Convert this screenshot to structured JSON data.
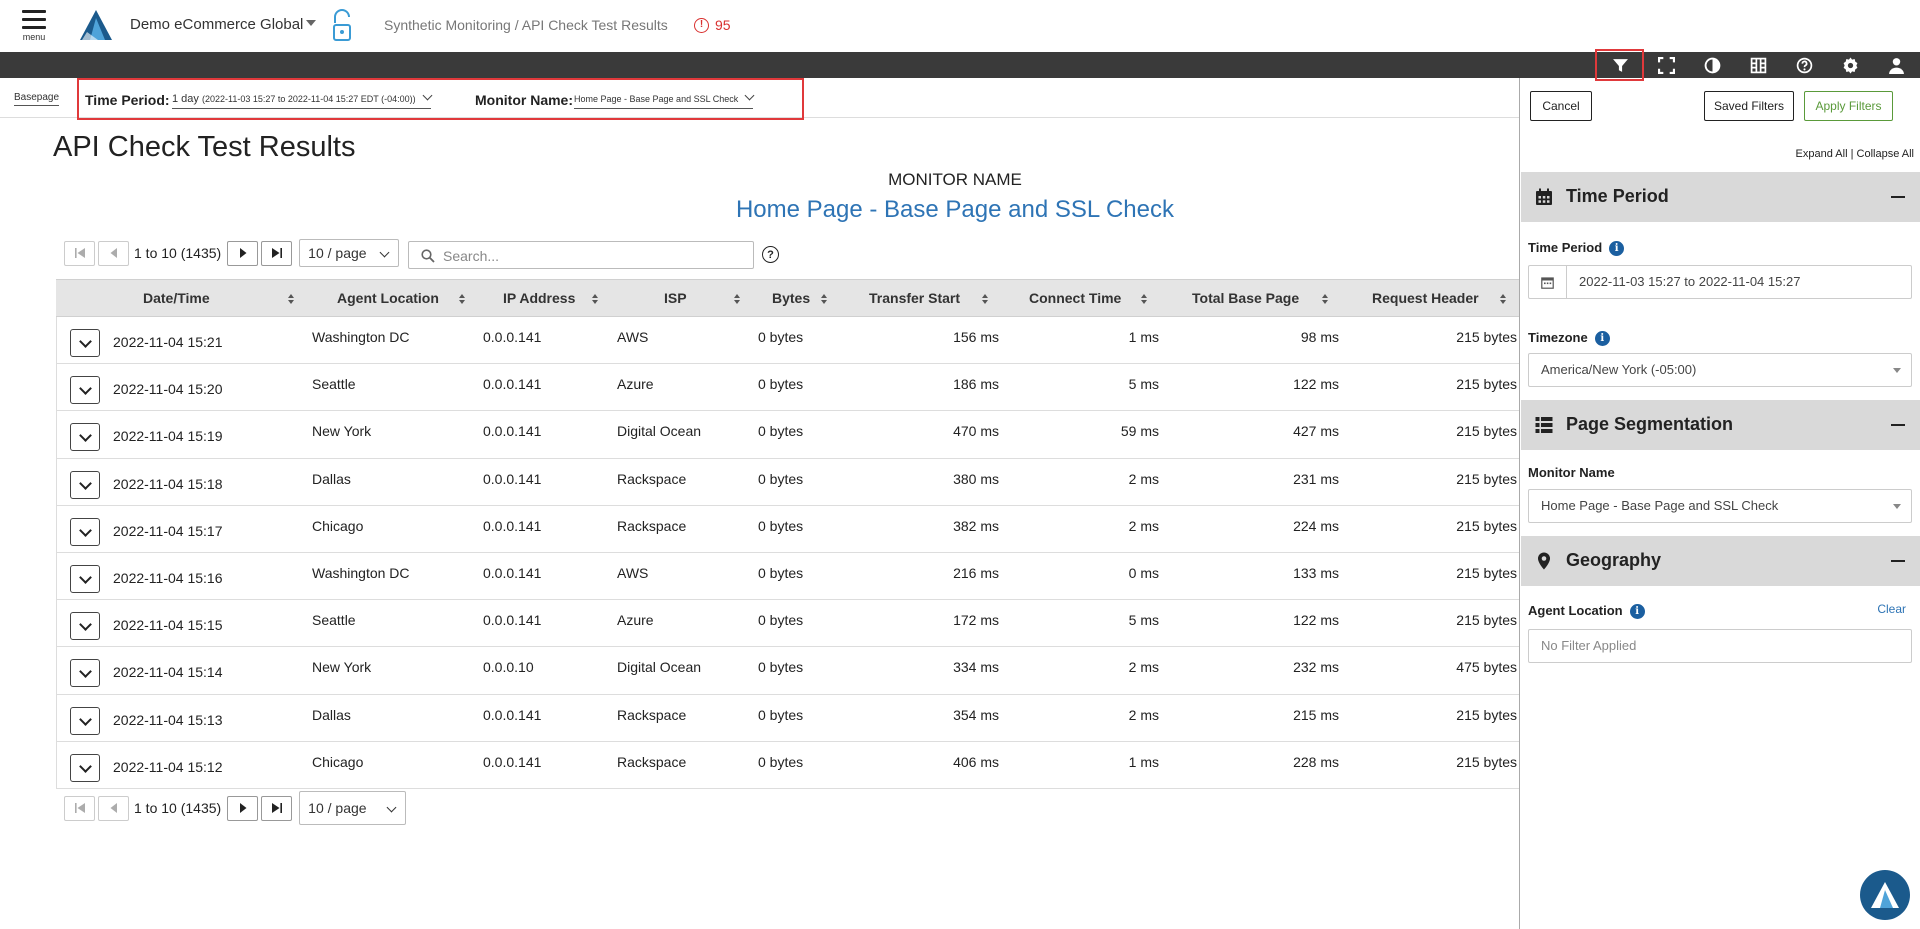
{
  "header": {
    "menu_label": "menu",
    "app_name": "Demo eCommerce Global",
    "breadcrumb": "Synthetic Monitoring / API Check Test Results",
    "alert_count": "95"
  },
  "toolbar": {
    "icons": [
      "filter-icon",
      "fullscreen-icon",
      "contrast-icon",
      "columns-icon",
      "help-icon",
      "gear-icon",
      "user-icon"
    ]
  },
  "filterbar": {
    "basepage": "Basepage",
    "time_period_label": "Time Period:",
    "time_period_value": "1 day",
    "time_period_range": "(2022-11-03 15:27 to 2022-11-04 15:27 EDT (-04:00))",
    "monitor_name_label": "Monitor Name:",
    "monitor_name_value": "Home Page - Base Page and SSL Check"
  },
  "main": {
    "title": "API Check Test Results",
    "monitor_label": "MONITOR NAME",
    "monitor_value": "Home Page - Base Page and SSL Check",
    "pager_count": "1 to 10 (1435)",
    "per_page": "10 / page",
    "search_placeholder": "Search...",
    "help": "?"
  },
  "table": {
    "columns": [
      "Date/Time",
      "Agent Location",
      "IP Address",
      "ISP",
      "Bytes",
      "Transfer Start",
      "Connect Time",
      "Total Base Page",
      "Request Header"
    ],
    "rows": [
      [
        "2022-11-04 15:21",
        "Washington DC",
        "0.0.0.141",
        "AWS",
        "0 bytes",
        "156 ms",
        "1 ms",
        "98 ms",
        "215 bytes"
      ],
      [
        "2022-11-04 15:20",
        "Seattle",
        "0.0.0.141",
        "Azure",
        "0 bytes",
        "186 ms",
        "5 ms",
        "122 ms",
        "215 bytes"
      ],
      [
        "2022-11-04 15:19",
        "New York",
        "0.0.0.141",
        "Digital Ocean",
        "0 bytes",
        "470 ms",
        "59 ms",
        "427 ms",
        "215 bytes"
      ],
      [
        "2022-11-04 15:18",
        "Dallas",
        "0.0.0.141",
        "Rackspace",
        "0 bytes",
        "380 ms",
        "2 ms",
        "231 ms",
        "215 bytes"
      ],
      [
        "2022-11-04 15:17",
        "Chicago",
        "0.0.0.141",
        "Rackspace",
        "0 bytes",
        "382 ms",
        "2 ms",
        "224 ms",
        "215 bytes"
      ],
      [
        "2022-11-04 15:16",
        "Washington DC",
        "0.0.0.141",
        "AWS",
        "0 bytes",
        "216 ms",
        "0 ms",
        "133 ms",
        "215 bytes"
      ],
      [
        "2022-11-04 15:15",
        "Seattle",
        "0.0.0.141",
        "Azure",
        "0 bytes",
        "172 ms",
        "5 ms",
        "122 ms",
        "215 bytes"
      ],
      [
        "2022-11-04 15:14",
        "New York",
        "0.0.0.10",
        "Digital Ocean",
        "0 bytes",
        "334 ms",
        "2 ms",
        "232 ms",
        "475 bytes"
      ],
      [
        "2022-11-04 15:13",
        "Dallas",
        "0.0.0.141",
        "Rackspace",
        "0 bytes",
        "354 ms",
        "2 ms",
        "215 ms",
        "215 bytes"
      ],
      [
        "2022-11-04 15:12",
        "Chicago",
        "0.0.0.141",
        "Rackspace",
        "0 bytes",
        "406 ms",
        "1 ms",
        "228 ms",
        "215 bytes"
      ]
    ]
  },
  "panel": {
    "cancel": "Cancel",
    "saved_filters": "Saved Filters",
    "apply_filters": "Apply Filters",
    "expand_all": "Expand All",
    "collapse_all": "Collapse All",
    "sections": {
      "time_period": {
        "title": "Time Period",
        "field_label": "Time Period",
        "field_value": "2022-11-03 15:27 to 2022-11-04 15:27",
        "timezone_label": "Timezone",
        "timezone_value": "America/New York (-05:00)"
      },
      "page_segmentation": {
        "title": "Page Segmentation",
        "monitor_label": "Monitor Name",
        "monitor_value": "Home Page - Base Page and SSL Check"
      },
      "geography": {
        "title": "Geography",
        "agent_label": "Agent Location",
        "clear": "Clear",
        "agent_placeholder": "No Filter Applied"
      }
    }
  },
  "colors": {
    "accent_blue": "#2e74b5",
    "alert_red": "#d9302f",
    "apply_green": "#5a9a3a",
    "toolbar_dark": "#3a3a3a"
  }
}
